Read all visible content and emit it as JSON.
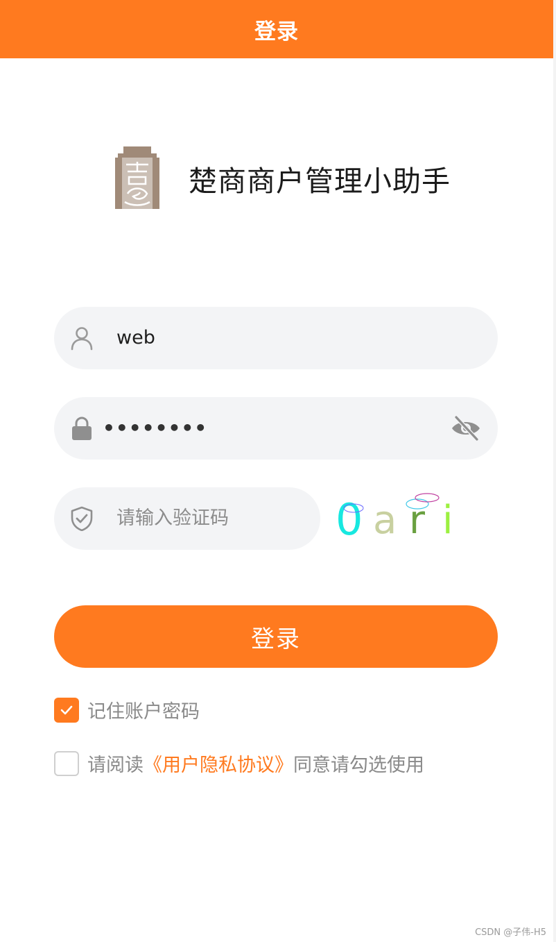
{
  "header": {
    "title": "登录"
  },
  "brand": {
    "app_name": "楚商商户管理小助手",
    "logo_icon": "chushang-seal-logo"
  },
  "form": {
    "username": {
      "value": "web",
      "icon": "user-icon"
    },
    "password": {
      "masked_value": "••••••••",
      "icon": "lock-icon",
      "toggle_icon": "eye-off-icon"
    },
    "captcha": {
      "placeholder": "请输入验证码",
      "icon": "shield-check-icon",
      "image_text": "0ari"
    }
  },
  "login_button": {
    "label": "登录"
  },
  "remember": {
    "label": "记住账户密码",
    "checked": true
  },
  "agreement": {
    "prefix": "请阅读",
    "link_text": "《用户隐私协议》",
    "suffix": "同意请勾选使用",
    "checked": false
  },
  "watermark": "CSDN @子伟-H5",
  "colors": {
    "accent": "#ff7a1f",
    "field_bg": "#f3f4f6",
    "logo": "#a08a78"
  }
}
